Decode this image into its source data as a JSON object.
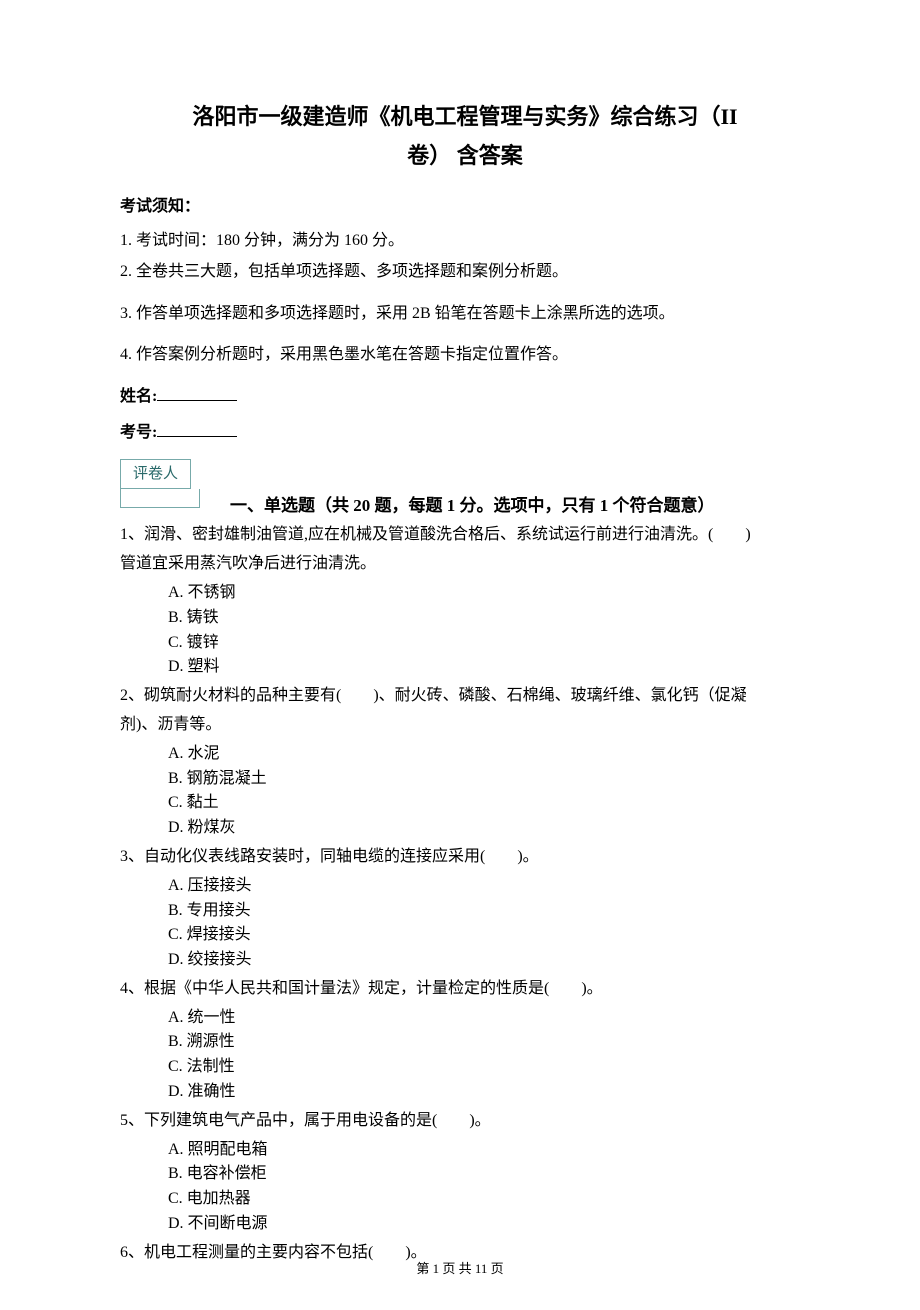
{
  "title_line1": "洛阳市一级建造师《机电工程管理与实务》综合练习（II",
  "title_line2": "卷）  含答案",
  "instructions_heading": "考试须知：",
  "instructions": [
    "1. 考试时间：180 分钟，满分为 160 分。",
    "2. 全卷共三大题，包括单项选择题、多项选择题和案例分析题。",
    "3. 作答单项选择题和多项选择题时，采用 2B 铅笔在答题卡上涂黑所选的选项。",
    "4. 作答案例分析题时，采用黑色墨水笔在答题卡指定位置作答。"
  ],
  "name_label": "姓名:",
  "exam_no_label": "考号:",
  "grader_label": "评卷人",
  "section1_heading": "一、单选题（共 20 题，每题 1 分。选项中，只有 1 个符合题意）",
  "questions": [
    {
      "stem_lines": [
        "1、润滑、密封雄制油管道,应在机械及管道酸洗合格后、系统试运行前进行油清洗。(　　)",
        "管道宜采用蒸汽吹净后进行油清洗。"
      ],
      "options": [
        "A. 不锈钢",
        "B. 铸铁",
        "C. 镀锌",
        "D. 塑料"
      ]
    },
    {
      "stem_lines": [
        "2、砌筑耐火材料的品种主要有(　　)、耐火砖、磷酸、石棉绳、玻璃纤维、氯化钙（促凝",
        "剂)、沥青等。"
      ],
      "options": [
        "A. 水泥",
        "B. 钢筋混凝土",
        "C. 黏土",
        "D. 粉煤灰"
      ]
    },
    {
      "stem_lines": [
        "3、自动化仪表线路安装时，同轴电缆的连接应采用(　　)。"
      ],
      "options": [
        "A. 压接接头",
        "B. 专用接头",
        "C. 焊接接头",
        "D. 绞接接头"
      ]
    },
    {
      "stem_lines": [
        "4、根据《中华人民共和国计量法》规定，计量检定的性质是(　　)。"
      ],
      "options": [
        "A. 统一性",
        "B. 溯源性",
        "C. 法制性",
        "D. 准确性"
      ]
    },
    {
      "stem_lines": [
        "5、下列建筑电气产品中，属于用电设备的是(　　)。"
      ],
      "options": [
        "A.  照明配电箱",
        "B.  电容补偿柜",
        "C.  电加热器",
        "D.  不间断电源"
      ]
    },
    {
      "stem_lines": [
        "6、机电工程测量的主要内容不包括(　　)。"
      ],
      "options": []
    }
  ],
  "footer": "第 1 页 共 11 页"
}
